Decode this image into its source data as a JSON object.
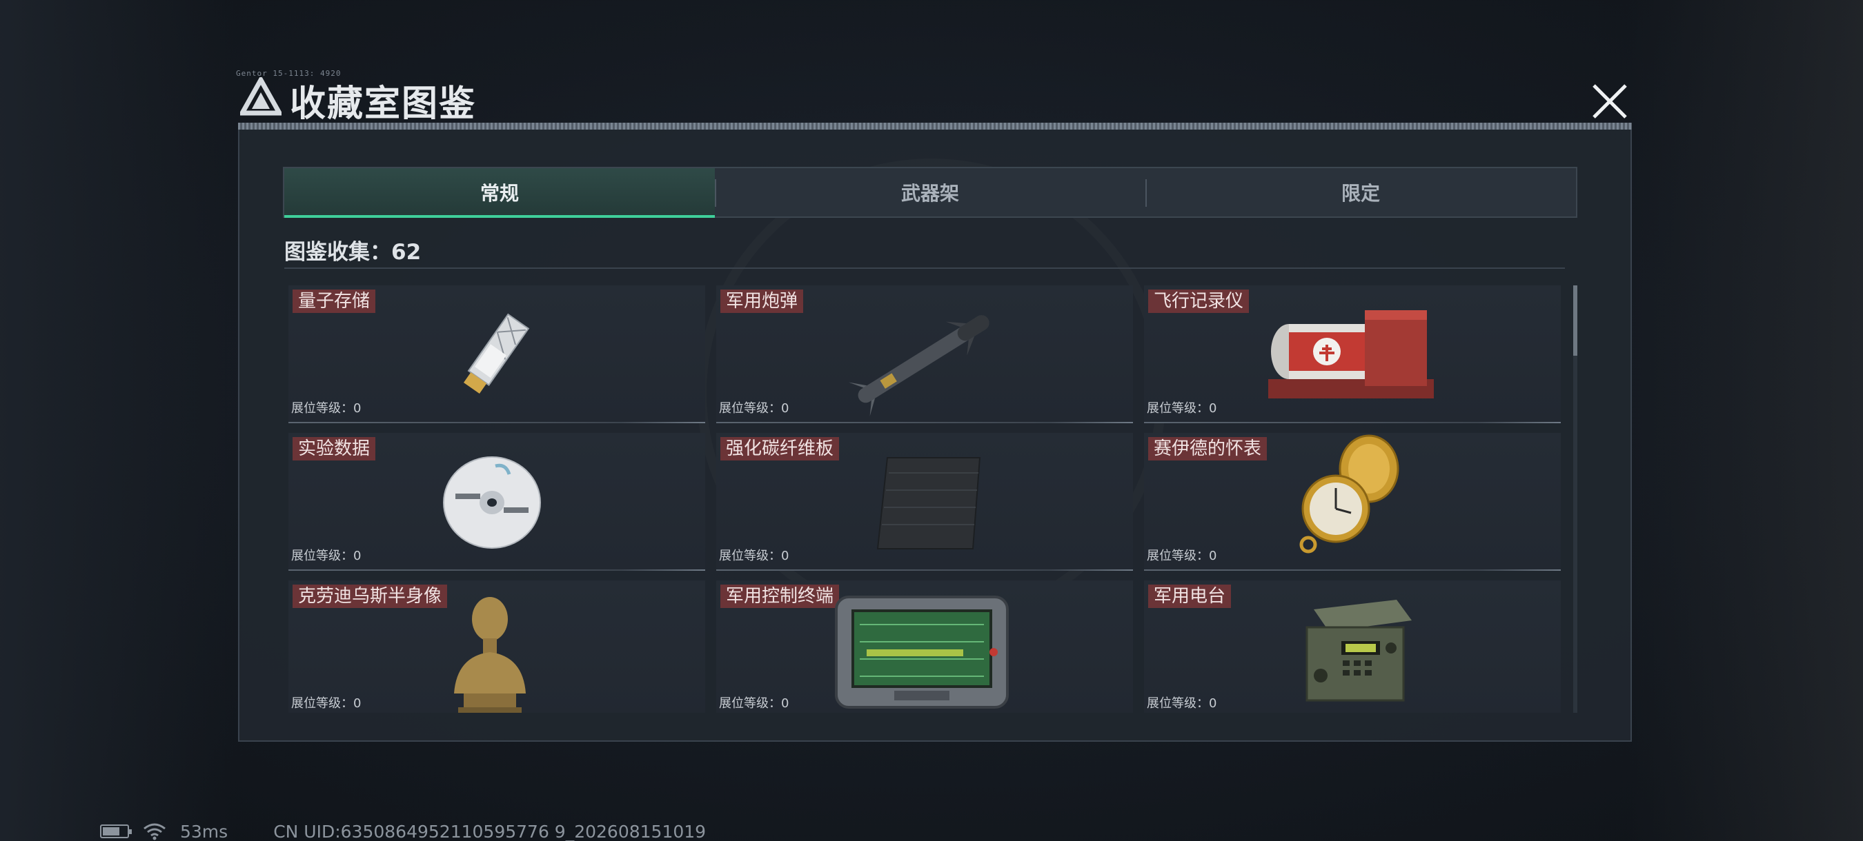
{
  "window": {
    "title": "收藏室图鉴",
    "caption": "Gentor 15-1113: 4920"
  },
  "tabs": [
    {
      "label": "常规",
      "active": true
    },
    {
      "label": "武器架",
      "active": false
    },
    {
      "label": "限定",
      "active": false
    }
  ],
  "collection": {
    "label": "图鉴收集：62"
  },
  "items": [
    {
      "name": "量子存储",
      "level": "展位等级：0",
      "icon": "usb-drive-icon"
    },
    {
      "name": "军用炮弹",
      "level": "展位等级：0",
      "icon": "missile-icon"
    },
    {
      "name": "飞行记录仪",
      "level": "展位等级：0",
      "icon": "flight-recorder-icon"
    },
    {
      "name": "实验数据",
      "level": "展位等级：0",
      "icon": "disc-icon"
    },
    {
      "name": "强化碳纤维板",
      "level": "展位等级：0",
      "icon": "carbon-plate-icon"
    },
    {
      "name": "赛伊德的怀表",
      "level": "展位等级：0",
      "icon": "pocket-watch-icon"
    },
    {
      "name": "克劳迪乌斯半身像",
      "level": "展位等级：0",
      "icon": "bust-statue-icon"
    },
    {
      "name": "军用控制终端",
      "level": "展位等级：0",
      "icon": "control-terminal-icon"
    },
    {
      "name": "军用电台",
      "level": "展位等级：0",
      "icon": "military-radio-icon"
    }
  ],
  "status": {
    "ping": "53ms",
    "uid": "CN UID:6350864952110595776 9_202608151019"
  },
  "colors": {
    "accent": "#3fcf9a",
    "label_bg": "#6b3437",
    "panel_bg": "#21272f"
  }
}
